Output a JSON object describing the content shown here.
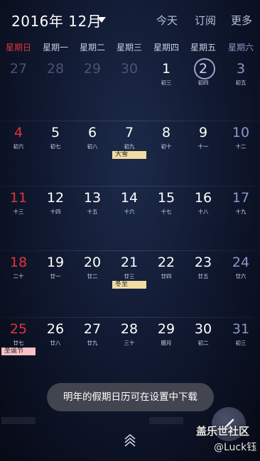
{
  "header": {
    "title": "2016年 12月",
    "actions": [
      "今天",
      "订阅",
      "更多"
    ]
  },
  "weekdays": [
    "星期日",
    "星期一",
    "星期二",
    "星期三",
    "星期四",
    "星期五",
    "星期六"
  ],
  "colors": {
    "sunday": "#e2343c",
    "saturday": "#8b97c8",
    "event_yellow": "#f1dca3",
    "event_pink": "#f6c0c5"
  },
  "weeks": [
    [
      {
        "day": "27",
        "lunar": "",
        "dim": true
      },
      {
        "day": "28",
        "lunar": "",
        "dim": true
      },
      {
        "day": "29",
        "lunar": "",
        "dim": true
      },
      {
        "day": "30",
        "lunar": "",
        "dim": true
      },
      {
        "day": "1",
        "lunar": "初三"
      },
      {
        "day": "2",
        "lunar": "初四",
        "today": true
      },
      {
        "day": "3",
        "lunar": "初五"
      }
    ],
    [
      {
        "day": "4",
        "lunar": "初六"
      },
      {
        "day": "5",
        "lunar": "初七"
      },
      {
        "day": "6",
        "lunar": "初八"
      },
      {
        "day": "7",
        "lunar": "初九",
        "event": "大雪",
        "event_color": "yellow"
      },
      {
        "day": "8",
        "lunar": "初十"
      },
      {
        "day": "9",
        "lunar": "十一"
      },
      {
        "day": "10",
        "lunar": "十二"
      }
    ],
    [
      {
        "day": "11",
        "lunar": "十三"
      },
      {
        "day": "12",
        "lunar": "十四"
      },
      {
        "day": "13",
        "lunar": "十五"
      },
      {
        "day": "14",
        "lunar": "十六"
      },
      {
        "day": "15",
        "lunar": "十七"
      },
      {
        "day": "16",
        "lunar": "十八"
      },
      {
        "day": "17",
        "lunar": "十九"
      }
    ],
    [
      {
        "day": "18",
        "lunar": "二十"
      },
      {
        "day": "19",
        "lunar": "廿一"
      },
      {
        "day": "20",
        "lunar": "廿二"
      },
      {
        "day": "21",
        "lunar": "廿三",
        "event": "冬至",
        "event_color": "yellow"
      },
      {
        "day": "22",
        "lunar": "廿四"
      },
      {
        "day": "23",
        "lunar": "廿五"
      },
      {
        "day": "24",
        "lunar": "廿六"
      }
    ],
    [
      {
        "day": "25",
        "lunar": "廿七",
        "event": "圣诞节",
        "event_color": "pink"
      },
      {
        "day": "26",
        "lunar": "廿八"
      },
      {
        "day": "27",
        "lunar": "廿九"
      },
      {
        "day": "28",
        "lunar": "三十"
      },
      {
        "day": "29",
        "lunar": "腊月"
      },
      {
        "day": "30",
        "lunar": "初二"
      },
      {
        "day": "31",
        "lunar": "初三"
      }
    ]
  ],
  "toast": "明年的假期日历可在设置中下载",
  "watermark": {
    "line1": "盖乐世社区",
    "line2": "@Luck钰"
  },
  "icons": {
    "dropdown": "caret-down-icon",
    "expand": "chevron-up-double-icon",
    "edit": "pencil-icon"
  }
}
